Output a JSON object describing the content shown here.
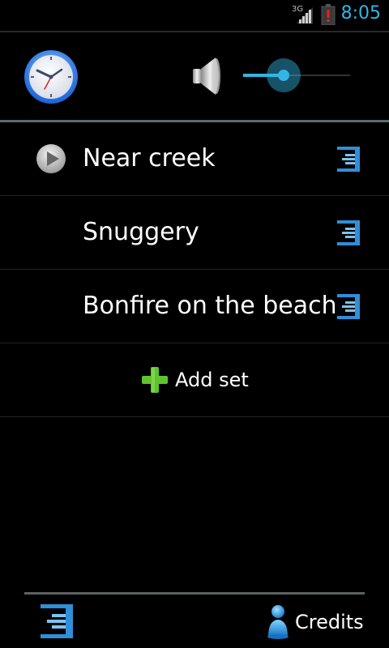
{
  "status_bar": {
    "network_type": "3G",
    "time": "8:05",
    "icons": [
      "signal-icon",
      "battery-alert-icon"
    ]
  },
  "header": {
    "icons": [
      "clock-icon",
      "speaker-icon"
    ],
    "volume_level": 0.38
  },
  "list": {
    "items": [
      {
        "label": "Near creek",
        "playing": true
      },
      {
        "label": "Snuggery",
        "playing": false
      },
      {
        "label": "Bonfire on the beach",
        "playing": false
      }
    ],
    "add_label": "Add set"
  },
  "bottom_bar": {
    "credits_label": "Credits"
  },
  "colors": {
    "accent": "#33b5e5",
    "add_green": "#5fc32e",
    "background": "#000000"
  }
}
